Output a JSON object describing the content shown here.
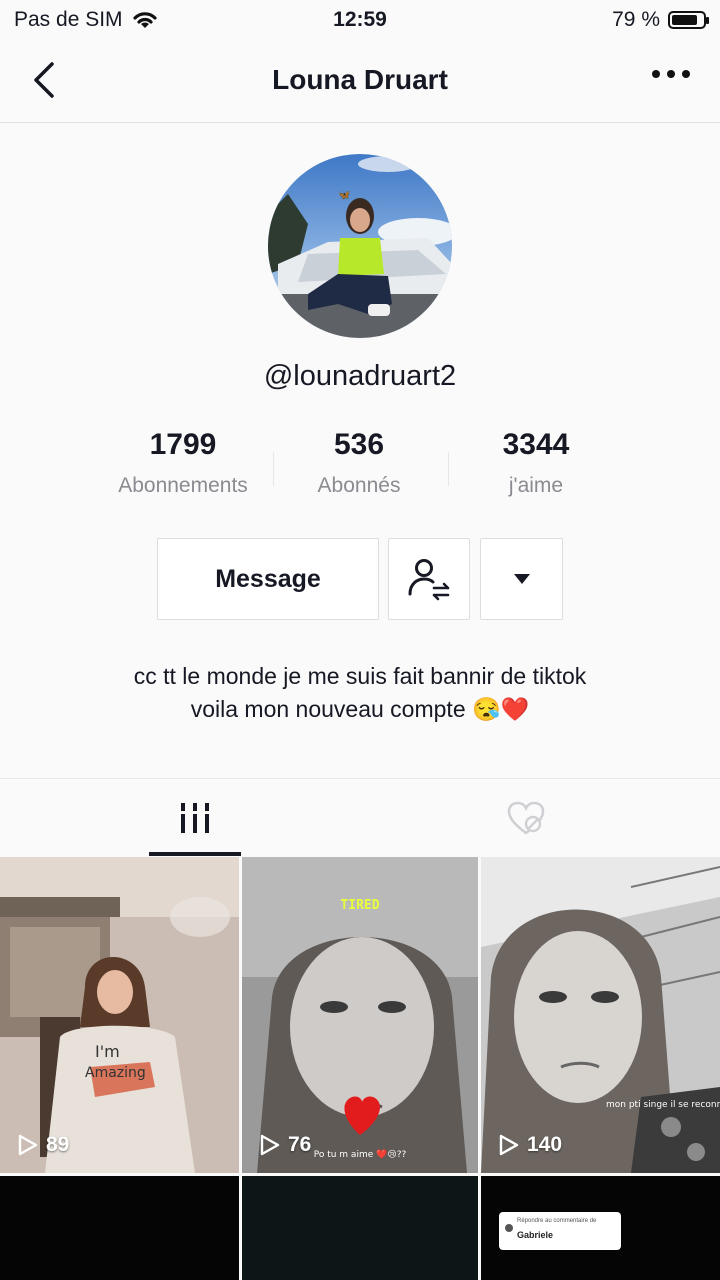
{
  "status_bar": {
    "carrier": "Pas de SIM",
    "time": "12:59",
    "battery": "79 %"
  },
  "nav": {
    "title": "Louna Druart"
  },
  "profile": {
    "username": "@lounadruart2"
  },
  "stats": [
    {
      "value": "1799",
      "label": "Abonnements"
    },
    {
      "value": "536",
      "label": "Abonnés"
    },
    {
      "value": "3344",
      "label": "j'aime"
    }
  ],
  "actions": {
    "message_label": "Message"
  },
  "bio": {
    "line1": "cc tt le monde je me suis fait bannir de tiktok",
    "line2": "voila mon nouveau compte 😪❤️"
  },
  "videos": [
    {
      "views": "89"
    },
    {
      "views": "76",
      "overlay_top": "TIRED",
      "caption": "Po tu m aime ❤️😢??"
    },
    {
      "views": "140",
      "caption": "mon pti singe il se reconnaitra 😆😂💕"
    }
  ],
  "comment_reply": {
    "title": "Répondre au commentaire de",
    "author": "Gabriele"
  }
}
